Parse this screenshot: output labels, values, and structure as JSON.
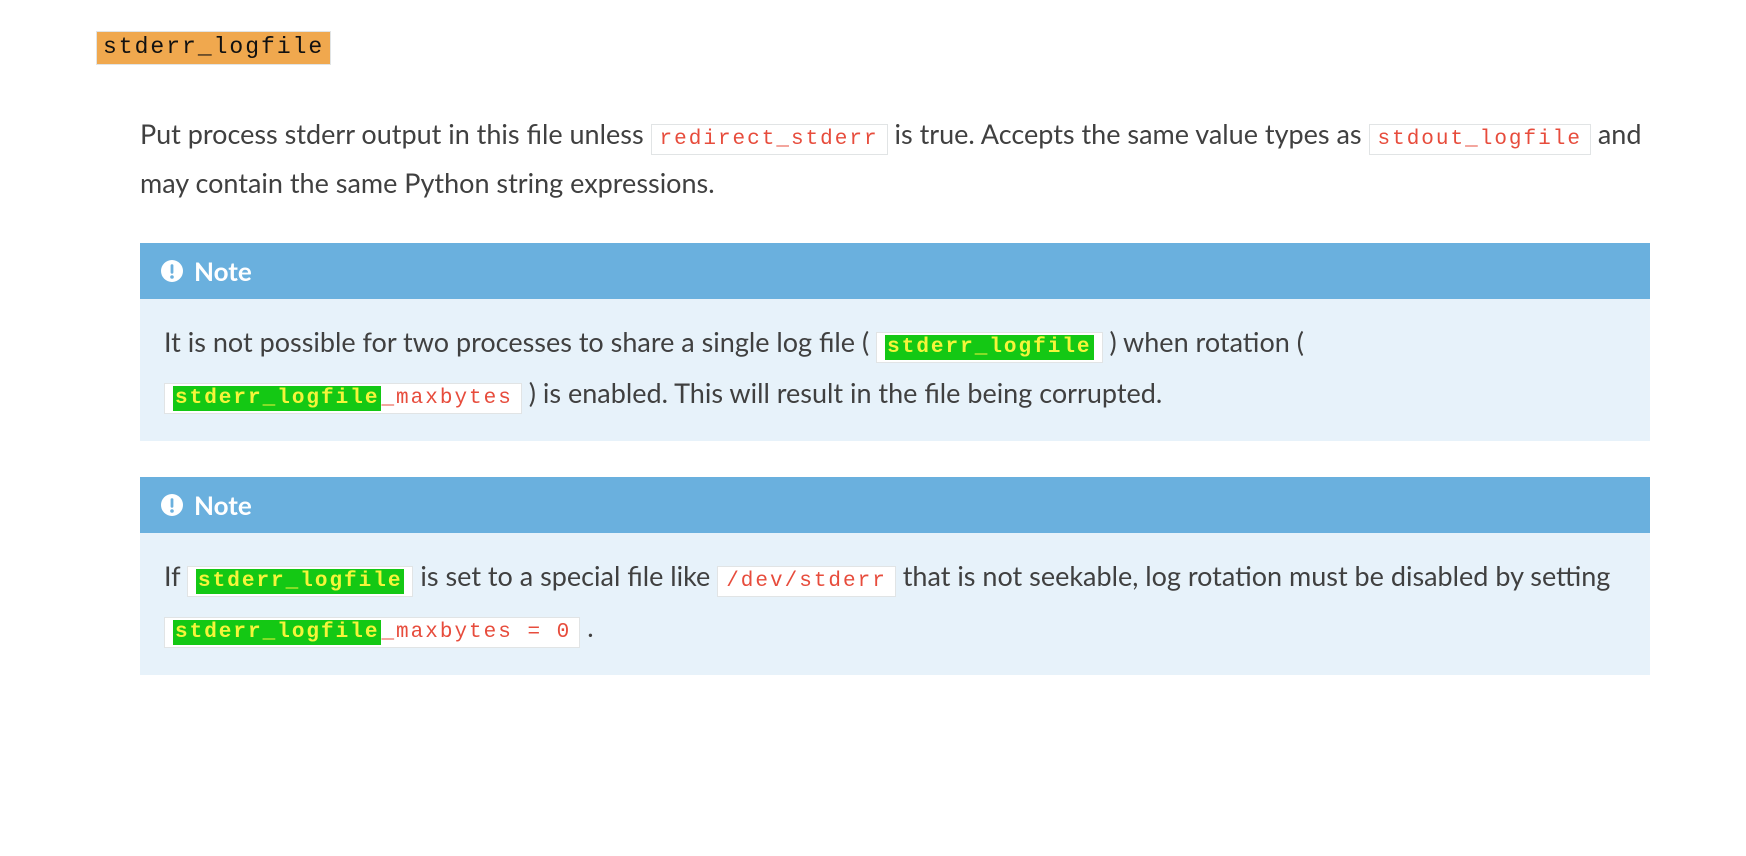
{
  "term": "stderr_logfile",
  "description": {
    "pre1": "Put process stderr output in this file unless ",
    "code1": "redirect_stderr",
    "mid1": " is true. Accepts the same value types as ",
    "code2": "stdout_logfile",
    "post1": " and may contain the same Python string expressions."
  },
  "note_label": "Note",
  "note1": {
    "pre": "It is not possible for two processes to share a single log file (",
    "code1_hl": "stderr_logfile",
    "mid1": ") when rotation (",
    "code2_hl": "stderr_logfile",
    "code2_tail": "_maxbytes",
    "post": ") is enabled. This will result in the file being corrupted."
  },
  "note2": {
    "pre": "If ",
    "code1_hl": "stderr_logfile",
    "mid1": " is set to a special file like ",
    "code2": "/dev/stderr",
    "mid2": " that is not seekable, log rotation must be disabled by setting ",
    "code3_hl": "stderr_logfile",
    "code3_tail": "_maxbytes = 0",
    "post": "."
  }
}
